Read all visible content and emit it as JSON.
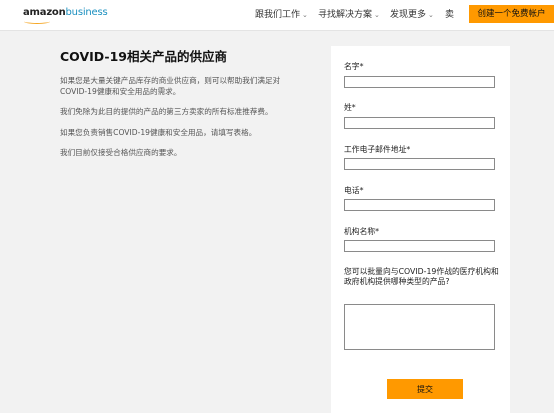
{
  "header": {
    "logo_amazon": "amazon",
    "logo_business": "business",
    "nav": [
      {
        "label": "跟我们工作",
        "chevron": "⌄"
      },
      {
        "label": "寻找解决方案",
        "chevron": "⌄"
      },
      {
        "label": "发现更多",
        "chevron": "⌄"
      },
      {
        "label": "卖",
        "chevron": ""
      }
    ],
    "cta_label": "创建一个免费帐户"
  },
  "intro": {
    "title": "COVID-19相关产品的供应商",
    "paragraphs": [
      "如果您是大量关键产品库存的商业供应商，则可以帮助我们满足对COVID-19健康和安全用品的需求。",
      "我们免除为此目的提供的产品的第三方卖家的所有标准推荐费。",
      "如果您负责销售COVID-19健康和安全用品，请填写表格。",
      "我们目前仅接受合格供应商的要求。"
    ]
  },
  "form": {
    "fields": [
      {
        "label": "名字*",
        "value": ""
      },
      {
        "label": "姓*",
        "value": ""
      },
      {
        "label": "工作电子邮件地址*",
        "value": ""
      },
      {
        "label": "电话*",
        "value": ""
      },
      {
        "label": "机构名称*",
        "value": ""
      }
    ],
    "question_label": "您可以批量向与COVID-19作战的医疗机构和政府机构提供哪种类型的产品?",
    "question_value": "",
    "submit_label": "提交"
  },
  "colors": {
    "accent": "#ff9900",
    "brand_blue": "#1a8fbf",
    "background": "#f2f2f2"
  }
}
